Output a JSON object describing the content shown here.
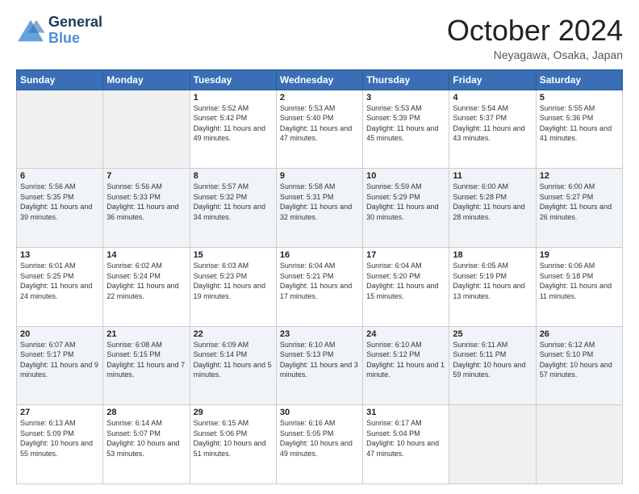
{
  "header": {
    "logo_line1": "General",
    "logo_line2": "Blue",
    "month_title": "October 2024",
    "location": "Neyagawa, Osaka, Japan"
  },
  "days_of_week": [
    "Sunday",
    "Monday",
    "Tuesday",
    "Wednesday",
    "Thursday",
    "Friday",
    "Saturday"
  ],
  "weeks": [
    [
      {
        "day": "",
        "info": ""
      },
      {
        "day": "",
        "info": ""
      },
      {
        "day": "1",
        "info": "Sunrise: 5:52 AM\nSunset: 5:42 PM\nDaylight: 11 hours and 49 minutes."
      },
      {
        "day": "2",
        "info": "Sunrise: 5:53 AM\nSunset: 5:40 PM\nDaylight: 11 hours and 47 minutes."
      },
      {
        "day": "3",
        "info": "Sunrise: 5:53 AM\nSunset: 5:39 PM\nDaylight: 11 hours and 45 minutes."
      },
      {
        "day": "4",
        "info": "Sunrise: 5:54 AM\nSunset: 5:37 PM\nDaylight: 11 hours and 43 minutes."
      },
      {
        "day": "5",
        "info": "Sunrise: 5:55 AM\nSunset: 5:36 PM\nDaylight: 11 hours and 41 minutes."
      }
    ],
    [
      {
        "day": "6",
        "info": "Sunrise: 5:56 AM\nSunset: 5:35 PM\nDaylight: 11 hours and 39 minutes."
      },
      {
        "day": "7",
        "info": "Sunrise: 5:56 AM\nSunset: 5:33 PM\nDaylight: 11 hours and 36 minutes."
      },
      {
        "day": "8",
        "info": "Sunrise: 5:57 AM\nSunset: 5:32 PM\nDaylight: 11 hours and 34 minutes."
      },
      {
        "day": "9",
        "info": "Sunrise: 5:58 AM\nSunset: 5:31 PM\nDaylight: 11 hours and 32 minutes."
      },
      {
        "day": "10",
        "info": "Sunrise: 5:59 AM\nSunset: 5:29 PM\nDaylight: 11 hours and 30 minutes."
      },
      {
        "day": "11",
        "info": "Sunrise: 6:00 AM\nSunset: 5:28 PM\nDaylight: 11 hours and 28 minutes."
      },
      {
        "day": "12",
        "info": "Sunrise: 6:00 AM\nSunset: 5:27 PM\nDaylight: 11 hours and 26 minutes."
      }
    ],
    [
      {
        "day": "13",
        "info": "Sunrise: 6:01 AM\nSunset: 5:25 PM\nDaylight: 11 hours and 24 minutes."
      },
      {
        "day": "14",
        "info": "Sunrise: 6:02 AM\nSunset: 5:24 PM\nDaylight: 11 hours and 22 minutes."
      },
      {
        "day": "15",
        "info": "Sunrise: 6:03 AM\nSunset: 5:23 PM\nDaylight: 11 hours and 19 minutes."
      },
      {
        "day": "16",
        "info": "Sunrise: 6:04 AM\nSunset: 5:21 PM\nDaylight: 11 hours and 17 minutes."
      },
      {
        "day": "17",
        "info": "Sunrise: 6:04 AM\nSunset: 5:20 PM\nDaylight: 11 hours and 15 minutes."
      },
      {
        "day": "18",
        "info": "Sunrise: 6:05 AM\nSunset: 5:19 PM\nDaylight: 11 hours and 13 minutes."
      },
      {
        "day": "19",
        "info": "Sunrise: 6:06 AM\nSunset: 5:18 PM\nDaylight: 11 hours and 11 minutes."
      }
    ],
    [
      {
        "day": "20",
        "info": "Sunrise: 6:07 AM\nSunset: 5:17 PM\nDaylight: 11 hours and 9 minutes."
      },
      {
        "day": "21",
        "info": "Sunrise: 6:08 AM\nSunset: 5:15 PM\nDaylight: 11 hours and 7 minutes."
      },
      {
        "day": "22",
        "info": "Sunrise: 6:09 AM\nSunset: 5:14 PM\nDaylight: 11 hours and 5 minutes."
      },
      {
        "day": "23",
        "info": "Sunrise: 6:10 AM\nSunset: 5:13 PM\nDaylight: 11 hours and 3 minutes."
      },
      {
        "day": "24",
        "info": "Sunrise: 6:10 AM\nSunset: 5:12 PM\nDaylight: 11 hours and 1 minute."
      },
      {
        "day": "25",
        "info": "Sunrise: 6:11 AM\nSunset: 5:11 PM\nDaylight: 10 hours and 59 minutes."
      },
      {
        "day": "26",
        "info": "Sunrise: 6:12 AM\nSunset: 5:10 PM\nDaylight: 10 hours and 57 minutes."
      }
    ],
    [
      {
        "day": "27",
        "info": "Sunrise: 6:13 AM\nSunset: 5:09 PM\nDaylight: 10 hours and 55 minutes."
      },
      {
        "day": "28",
        "info": "Sunrise: 6:14 AM\nSunset: 5:07 PM\nDaylight: 10 hours and 53 minutes."
      },
      {
        "day": "29",
        "info": "Sunrise: 6:15 AM\nSunset: 5:06 PM\nDaylight: 10 hours and 51 minutes."
      },
      {
        "day": "30",
        "info": "Sunrise: 6:16 AM\nSunset: 5:05 PM\nDaylight: 10 hours and 49 minutes."
      },
      {
        "day": "31",
        "info": "Sunrise: 6:17 AM\nSunset: 5:04 PM\nDaylight: 10 hours and 47 minutes."
      },
      {
        "day": "",
        "info": ""
      },
      {
        "day": "",
        "info": ""
      }
    ]
  ]
}
